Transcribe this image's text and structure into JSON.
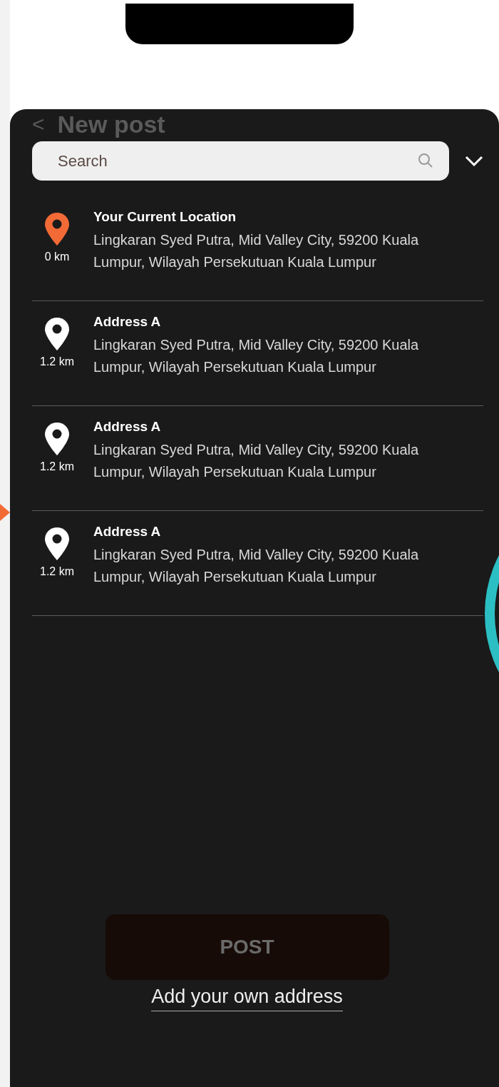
{
  "header": {
    "back": "<",
    "title": "New post"
  },
  "search": {
    "placeholder": "Search"
  },
  "locations": [
    {
      "kind": "current",
      "name": "Your Current Location",
      "address": "Lingkaran Syed Putra, Mid Valley City, 59200 Kuala Lumpur, Wilayah Persekutuan Kuala Lumpur",
      "distance": "0 km"
    },
    {
      "kind": "address",
      "name": "Address A",
      "address": "Lingkaran Syed Putra, Mid Valley City, 59200 Kuala Lumpur, Wilayah Persekutuan Kuala Lumpur",
      "distance": "1.2 km"
    },
    {
      "kind": "address",
      "name": "Address A",
      "address": "Lingkaran Syed Putra, Mid Valley City, 59200 Kuala Lumpur, Wilayah Persekutuan Kuala Lumpur",
      "distance": "1.2 km"
    },
    {
      "kind": "address",
      "name": "Address A",
      "address": "Lingkaran Syed Putra, Mid Valley City, 59200 Kuala Lumpur, Wilayah Persekutuan Kuala Lumpur",
      "distance": "1.2 km"
    }
  ],
  "post_button": "POST",
  "add_address_link": "Add your own address"
}
